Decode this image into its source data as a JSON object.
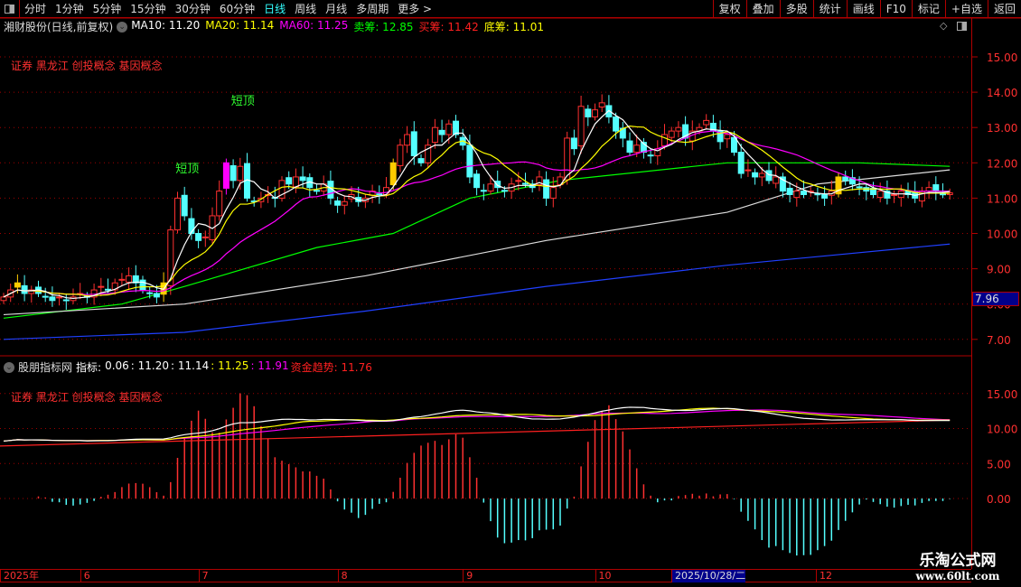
{
  "toolbar": {
    "periods": [
      "分时",
      "1分钟",
      "5分钟",
      "15分钟",
      "30分钟",
      "60分钟",
      "日线",
      "周线",
      "月线",
      "多周期",
      "更多 >"
    ],
    "active": "日线",
    "buttons": [
      "复权",
      "叠加",
      "多股",
      "统计",
      "画线",
      "F10",
      "标记",
      "+自选",
      "返回"
    ]
  },
  "main_legend": {
    "title": "湘财股份(日线,前复权)",
    "items": [
      {
        "text": "MA10: 11.20",
        "color": "#ffffff"
      },
      {
        "text": "MA20: 11.14",
        "color": "#ffff00"
      },
      {
        "text": "MA60: 11.25",
        "color": "#ff00ff"
      },
      {
        "text": "卖筹: 12.85",
        "color": "#00ff00"
      },
      {
        "text": "买筹: 11.42",
        "color": "#ff2020"
      },
      {
        "text": "底筹: 11.01",
        "color": "#ffff00"
      }
    ]
  },
  "concepts": "证券 黑龙江 创投概念 基因概念",
  "annotations": [
    {
      "text": "短顶",
      "index": 26
    },
    {
      "text": "短顶",
      "index": 34
    }
  ],
  "current_price": "7.96",
  "sub_legend": {
    "title": "股朋指标网",
    "label": "指标:",
    "items": [
      {
        "text": "0.06",
        "color": "#ffffff"
      },
      {
        "text": ": 11.20",
        "color": "#ffffff"
      },
      {
        "text": ": 11.14",
        "color": "#ffffff"
      },
      {
        "text": ": 11.25",
        "color": "#ffff00"
      },
      {
        "text": ": 11.91",
        "color": "#ff00ff"
      },
      {
        "text": "资金趋势: 11.76",
        "color": "#ff2020"
      }
    ]
  },
  "dates": {
    "labels": [
      {
        "t": "2025年",
        "i": 0
      },
      {
        "t": "6",
        "i": 11
      },
      {
        "t": "7",
        "i": 28
      },
      {
        "t": "8",
        "i": 48
      },
      {
        "t": "9",
        "i": 66
      },
      {
        "t": "10",
        "i": 85
      }
    ],
    "highlight": "2025/10/28/二",
    "tail": "12"
  },
  "watermark": {
    "line1": "乐淘公式网",
    "line2": "www.60lt.com"
  },
  "chart_data": {
    "type": "candlestick",
    "price_axis": {
      "ticks": [
        "15.00",
        "14.00",
        "13.00",
        "12.00",
        "11.00",
        "10.00",
        "9.00",
        "8.00",
        "7.00"
      ],
      "range": [
        6.6,
        15.6
      ]
    },
    "sub_axis": {
      "ticks": [
        "15.00",
        "10.00",
        "5.00",
        "0.00"
      ],
      "range": [
        -9.5,
        18.5
      ]
    },
    "closes": [
      8.2,
      8.4,
      8.6,
      8.3,
      8.4,
      8.3,
      8.2,
      8.1,
      8.2,
      8.1,
      8.2,
      8.3,
      8.2,
      8.4,
      8.5,
      8.4,
      8.6,
      8.7,
      8.8,
      8.6,
      8.4,
      8.3,
      8.2,
      8.6,
      10.1,
      11.0,
      10.5,
      10.0,
      9.8,
      9.9,
      10.5,
      11.2,
      12.0,
      11.5,
      11.9,
      11.0,
      10.9,
      11.0,
      11.1,
      11.0,
      11.5,
      11.4,
      11.6,
      11.5,
      11.3,
      11.2,
      11.4,
      11.0,
      10.8,
      10.9,
      11.1,
      10.9,
      11.0,
      11.2,
      11.1,
      11.3,
      12.0,
      12.5,
      12.8,
      12.2,
      12.0,
      12.5,
      13.0,
      12.8,
      13.1,
      12.8,
      12.5,
      11.6,
      11.3,
      11.2,
      11.4,
      11.3,
      11.2,
      11.4,
      11.5,
      11.4,
      11.3,
      11.6,
      11.0,
      11.3,
      11.6,
      12.7,
      12.4,
      13.6,
      13.3,
      13.5,
      13.7,
      13.3,
      12.9,
      12.7,
      12.3,
      12.5,
      12.3,
      12.2,
      12.4,
      12.8,
      12.9,
      13.0,
      12.7,
      12.9,
      13.0,
      13.2,
      12.9,
      12.6,
      12.8,
      12.3,
      11.7,
      11.8,
      11.6,
      11.7,
      11.5,
      11.6,
      11.2,
      11.1,
      11.2,
      11.1,
      11.2,
      11.1,
      11.0,
      11.2,
      11.6,
      11.5,
      11.4,
      11.3,
      11.2,
      11.1,
      11.2,
      11.0,
      11.1,
      11.2,
      11.1,
      11.0,
      11.2,
      11.3,
      11.2,
      11.1,
      11.15
    ],
    "highlight_yellow": [
      2,
      23,
      56,
      120
    ],
    "highlight_magenta": [
      32
    ],
    "long_ma": [
      {
        "name": "MA60",
        "color": "#00ff00",
        "points": [
          [
            0,
            7.6
          ],
          [
            17,
            8.0
          ],
          [
            26,
            8.5
          ],
          [
            45,
            9.6
          ],
          [
            56,
            10.0
          ],
          [
            67,
            11.0
          ],
          [
            80,
            11.5
          ],
          [
            104,
            12.0
          ],
          [
            123,
            12.0
          ],
          [
            136,
            11.9
          ]
        ]
      },
      {
        "name": "MA120",
        "color": "#dddddd",
        "points": [
          [
            0,
            7.7
          ],
          [
            26,
            8.0
          ],
          [
            52,
            8.8
          ],
          [
            78,
            9.8
          ],
          [
            104,
            10.6
          ],
          [
            117,
            11.4
          ],
          [
            136,
            11.8
          ]
        ]
      },
      {
        "name": "MA250",
        "color": "#2040ff",
        "points": [
          [
            0,
            7.0
          ],
          [
            26,
            7.2
          ],
          [
            52,
            7.8
          ],
          [
            78,
            8.5
          ],
          [
            104,
            9.1
          ],
          [
            136,
            9.7
          ]
        ]
      }
    ],
    "sub_trend": {
      "color": "#ff2020",
      "from": 7.5,
      "to": 11.2
    }
  }
}
